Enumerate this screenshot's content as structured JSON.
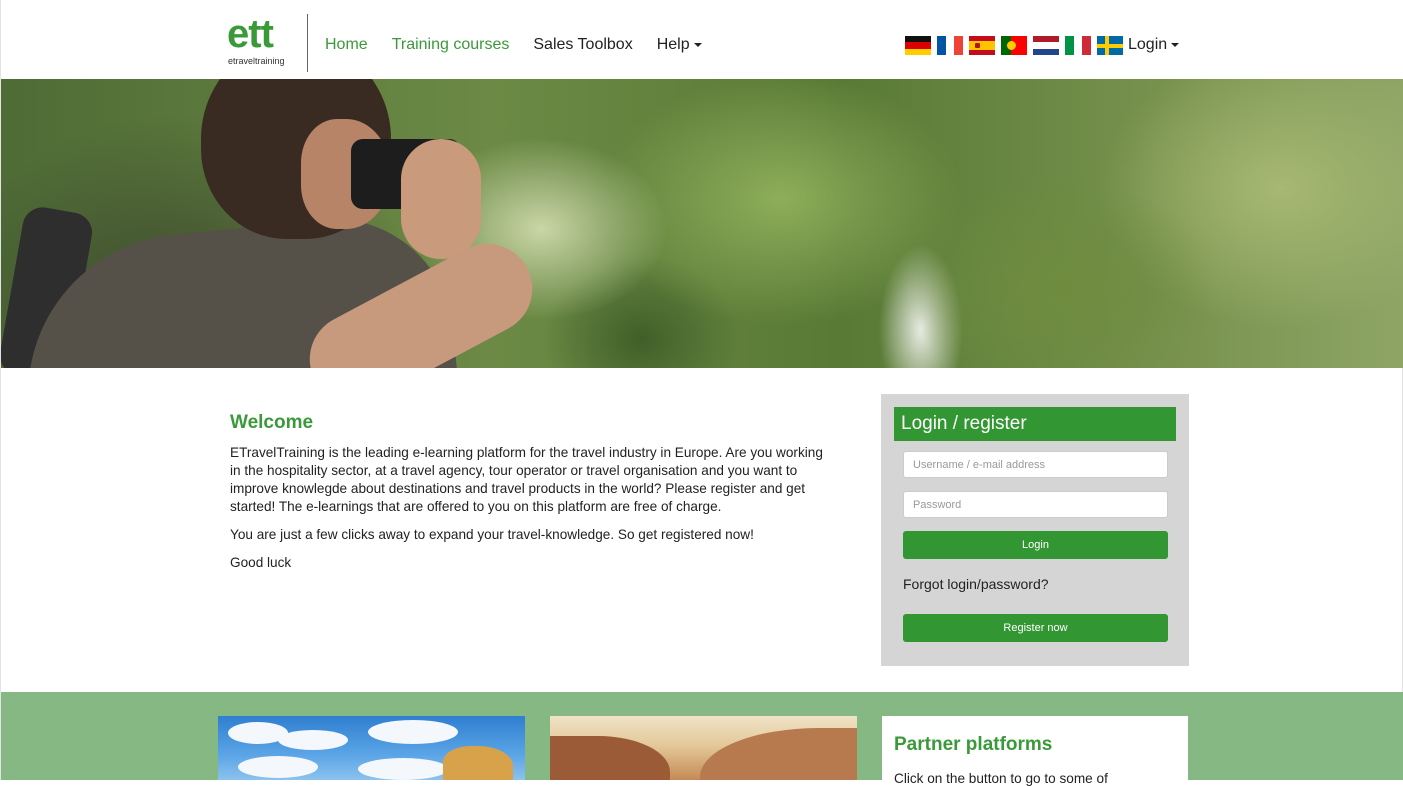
{
  "header": {
    "logo": {
      "main": "ett",
      "sub": "etraveltraining"
    },
    "nav": [
      {
        "label": "Home"
      },
      {
        "label": "Training courses"
      },
      {
        "label": "Sales Toolbox"
      },
      {
        "label": "Help"
      }
    ],
    "flags": [
      "german-flag-icon",
      "french-flag-icon",
      "spanish-flag-icon",
      "portuguese-flag-icon",
      "dutch-flag-icon",
      "italian-flag-icon",
      "swedish-flag-icon"
    ],
    "login": "Login"
  },
  "welcome": {
    "title": "Welcome",
    "paragraphs": [
      "ETravelTraining is the leading e-learning platform for the travel industry in Europe. Are you working in the hospitality sector, at a travel agency, tour operator or travel organisation and you want to improve knowlegde about destinations and travel products in the world? Please register and get started! The e-learnings that are offered to you on this platform are free of charge.",
      "You are just a few clicks away to expand your travel-knowledge. So get registered now!",
      "Good luck"
    ]
  },
  "login_panel": {
    "title": "Login / register",
    "username_placeholder": "Username / e-mail address",
    "password_placeholder": "Password",
    "login_button": "Login",
    "forgot": "Forgot login/password?",
    "register_button": "Register now"
  },
  "partner": {
    "title": "Partner platforms",
    "text": "Click on the button to go to some of"
  },
  "colors": {
    "brand_green": "#3a9a3a",
    "button_green": "#329632",
    "band_green": "#86b883",
    "panel_grey": "#d5d5d5"
  }
}
